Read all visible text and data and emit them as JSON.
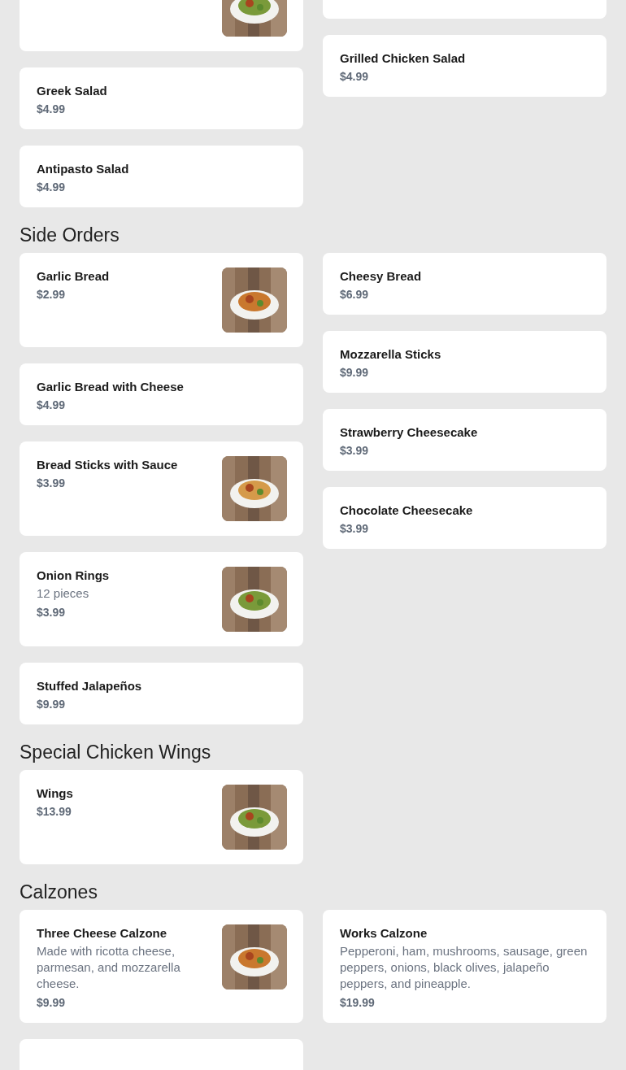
{
  "sections": [
    {
      "columns": [
        [
          {
            "picture": true
          },
          {
            "name": "Greek Salad",
            "price": "$4.99"
          },
          {
            "name": "Antipasto Salad",
            "price": "$4.99"
          }
        ],
        [
          {},
          {
            "name": "Grilled Chicken Salad",
            "price": "$4.99"
          }
        ]
      ]
    },
    {
      "title": "Side Orders",
      "columns": [
        [
          {
            "name": "Garlic Bread",
            "price": "$2.99",
            "picture": true
          },
          {
            "name": "Garlic Bread with Cheese",
            "price": "$4.99"
          },
          {
            "name": "Bread Sticks with Sauce",
            "price": "$3.99",
            "picture": true
          },
          {
            "name": "Onion Rings",
            "description": "12 pieces",
            "price": "$3.99",
            "picture": true
          },
          {
            "name": "Stuffed Jalapeños",
            "price": "$9.99"
          }
        ],
        [
          {
            "name": "Cheesy Bread",
            "price": "$6.99"
          },
          {
            "name": "Mozzarella Sticks",
            "price": "$9.99"
          },
          {
            "name": "Strawberry Cheesecake",
            "price": "$3.99"
          },
          {
            "name": "Chocolate Cheesecake",
            "price": "$3.99"
          }
        ]
      ]
    },
    {
      "title": "Special Chicken Wings",
      "columns": [
        [
          {
            "name": "Wings",
            "price": "$13.99",
            "picture": true
          }
        ],
        []
      ]
    },
    {
      "title": "Calzones",
      "columns": [
        [
          {
            "name": "Three Cheese Calzone",
            "description": "Made with ricotta cheese, parmesan, and mozzarella cheese.",
            "price": "$9.99",
            "picture": true
          },
          {}
        ],
        [
          {
            "name": "Works Calzone",
            "description": "Pepperoni, ham, mushrooms, sausage, green peppers, onions, black olives, jalapeño peppers, and pineapple.",
            "price": "$19.99"
          }
        ]
      ]
    }
  ]
}
